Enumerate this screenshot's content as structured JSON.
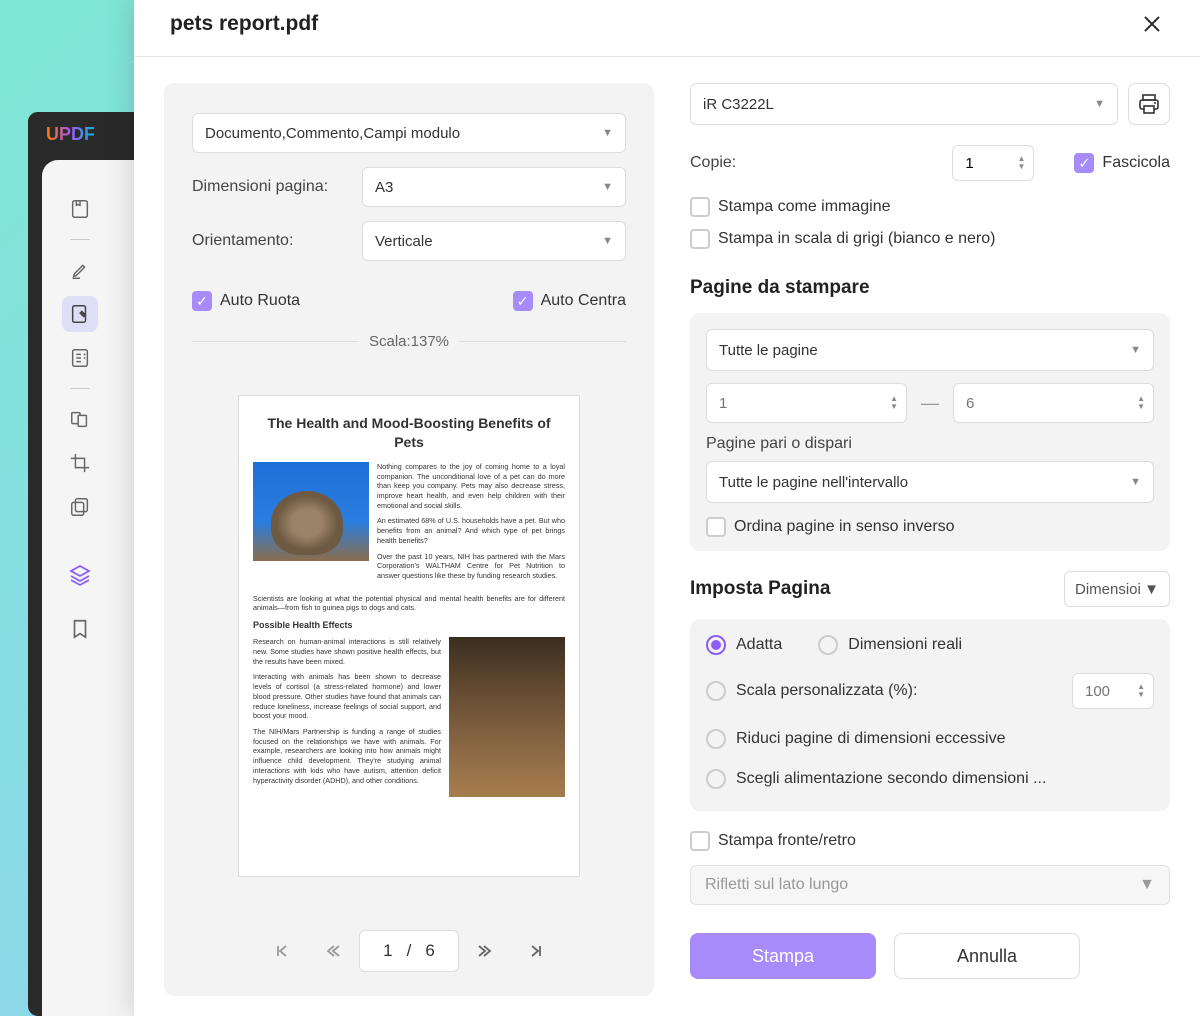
{
  "doc_title": "pets report.pdf",
  "logo": "UPDF",
  "left_col": {
    "layers_label": "Documento,Commento,Campi modulo",
    "page_size_label": "Dimensioni pagina:",
    "page_size_value": "A3",
    "orientation_label": "Orientamento:",
    "orientation_value": "Verticale",
    "auto_rotate": "Auto Ruota",
    "auto_center": "Auto Centra",
    "scale_text": "Scala:137%",
    "preview": {
      "h1": "The Health and Mood-Boosting Benefits of Pets",
      "p1": "Nothing compares to the joy of coming home to a loyal companion. The unconditional love of a pet can do more than keep you company. Pets may also decrease stress, improve heart health, and even help children with their emotional and social skills.",
      "p2": "An estimated 68% of U.S. households have a pet. But who benefits from an animal? And which type of pet brings health benefits?",
      "p3": "Over the past 10 years, NIH has partnered with the Mars Corporation's WALTHAM Centre for Pet Nutrition to answer questions like these by funding research studies.",
      "p4": "Scientists are looking at what the potential physical and mental health benefits are for different animals—from fish to guinea pigs to dogs and cats.",
      "h2": "Possible Health Effects",
      "p5": "Research on human-animal interactions is still relatively new. Some studies have shown positive health effects, but the results have been mixed.",
      "p6": "Interacting with animals has been shown to decrease levels of cortisol (a stress-related hormone) and lower blood pressure. Other studies have found that animals can reduce loneliness, increase feelings of social support, and boost your mood.",
      "p7": "The NIH/Mars Partnership is funding a range of studies focused on the relationships we have with animals. For example, researchers are looking into how animals might influence child development. They're studying animal interactions with kids who have autism, attention deficit hyperactivity disorder (ADHD), and other conditions."
    },
    "pager": {
      "current": "1",
      "sep": "/",
      "total": "6"
    }
  },
  "right_col": {
    "printer": "iR C3222L",
    "copies_label": "Copie:",
    "copies_value": "1",
    "collate": "Fascicola",
    "print_as_image": "Stampa come immagine",
    "print_grayscale": "Stampa in scala di grigi (bianco e nero)",
    "pages_section": "Pagine da stampare",
    "pages_sel": "Tutte le pagine",
    "range_from": "1",
    "range_to": "6",
    "odd_even_label": "Pagine pari o dispari",
    "odd_even_sel": "Tutte le pagine nell'intervallo",
    "reverse": "Ordina pagine in senso inverso",
    "setup_section": "Imposta Pagina",
    "size_sel": "Dimensioi",
    "radio_fit": "Adatta",
    "radio_actual": "Dimensioni reali",
    "radio_custom": "Scala personalizzata (%):",
    "custom_scale": "100",
    "radio_shrink": "Riduci pagine di dimensioni eccessive",
    "radio_feed": "Scegli alimentazione secondo dimensioni ...",
    "duplex": "Stampa fronte/retro",
    "duplex_sel": "Rifletti sul lato lungo",
    "btn_print": "Stampa",
    "btn_cancel": "Annulla"
  }
}
